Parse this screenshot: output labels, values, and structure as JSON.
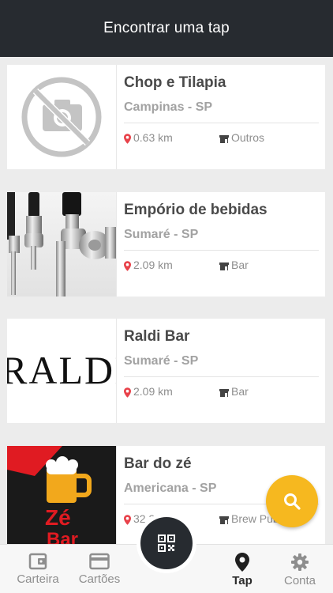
{
  "header": {
    "title": "Encontrar uma tap"
  },
  "venues": [
    {
      "name": "Chop e Tilapia",
      "city": "Campinas - SP",
      "distance": "0.63 km",
      "category": "Outros",
      "image": "no-photo-icon"
    },
    {
      "name": "Empório de bebidas",
      "city": "Sumaré - SP",
      "distance": "2.09 km",
      "category": "Bar",
      "image": "beer-taps-photo"
    },
    {
      "name": "Raldi Bar",
      "city": "Sumaré - SP",
      "distance": "2.09 km",
      "category": "Bar",
      "image": "raldi-logo",
      "logo_text": "RALDI"
    },
    {
      "name": "Bar do zé",
      "city": "Americana - SP",
      "distance": "32.35 km",
      "category": "Brew Pub",
      "image": "ze-bar-logo",
      "logo_text": [
        "Zé",
        "Bar"
      ]
    }
  ],
  "bottom_nav": {
    "items": [
      {
        "label": "Carteira",
        "icon": "wallet-icon"
      },
      {
        "label": "Cartões",
        "icon": "card-icon"
      },
      {
        "label": "Tap",
        "icon": "map-pin-icon",
        "active": true
      },
      {
        "label": "Conta",
        "icon": "gear-icon"
      }
    ]
  },
  "colors": {
    "header": "#272b30",
    "accent": "#f6b81f",
    "pin": "#e8424a"
  }
}
